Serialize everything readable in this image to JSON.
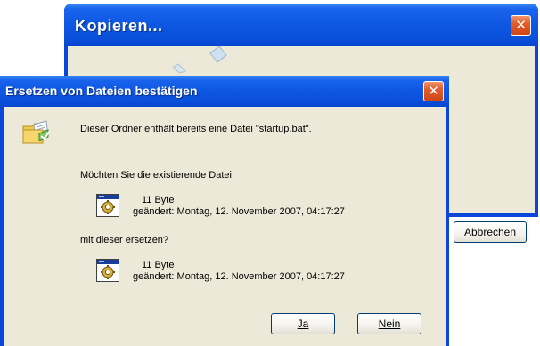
{
  "back_window": {
    "title": "Kopieren...",
    "close_glyph": "✕",
    "cancel_label": "Abbrechen"
  },
  "dialog": {
    "title": "Ersetzen von Dateien bestätigen",
    "close_glyph": "✕",
    "message": "Dieser Ordner enthält bereits eine Datei \"startup.bat\".",
    "question_existing": "Möchten Sie die existierende Datei",
    "existing_file": {
      "size": "11 Byte",
      "modified": "geändert: Montag, 12. November 2007, 04:17:27"
    },
    "question_replace": "mit dieser ersetzen?",
    "new_file": {
      "size": "11 Byte",
      "modified": "geändert: Montag, 12. November 2007, 04:17:27"
    },
    "yes_label": "Ja",
    "no_label": "Nein"
  },
  "icons": {
    "folder": "folder-icon",
    "batch_file": "batch-file-icon",
    "close": "close-icon"
  },
  "colors": {
    "titlebar_blue": "#0a52dc",
    "dialog_face": "#ece9d8",
    "close_red": "#e35c2a"
  }
}
